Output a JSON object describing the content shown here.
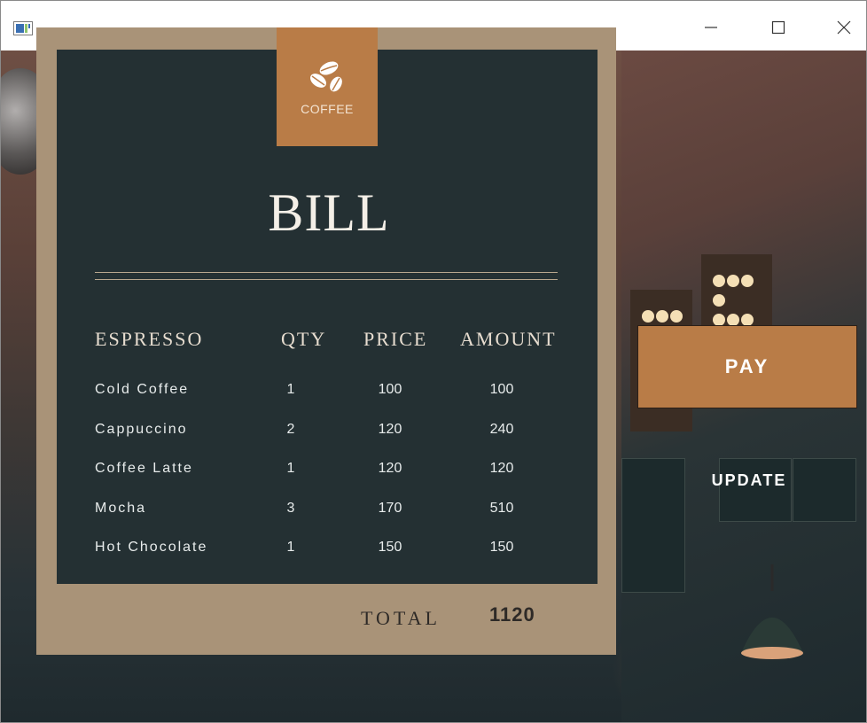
{
  "window": {
    "icon": "app-window-icon",
    "controls": [
      "minimize-icon",
      "maximize-icon",
      "close-icon"
    ]
  },
  "badge": {
    "label": "COFFEE",
    "icon": "coffee-beans-icon"
  },
  "bill": {
    "title": "BILL",
    "columns": [
      "ESPRESSO",
      "QTY",
      "PRICE",
      "AMOUNT"
    ],
    "rows": [
      {
        "item": "Cold Coffee",
        "qty": "1",
        "price": "100",
        "amount": "100"
      },
      {
        "item": "Cappuccino",
        "qty": "2",
        "price": "120",
        "amount": "240"
      },
      {
        "item": "Coffee Latte",
        "qty": "1",
        "price": "120",
        "amount": "120"
      },
      {
        "item": "Mocha",
        "qty": "3",
        "price": "170",
        "amount": "510"
      },
      {
        "item": "Hot Chocolate",
        "qty": "1",
        "price": "150",
        "amount": "150"
      }
    ],
    "total_label": "TOTAL",
    "total_value": "1120"
  },
  "actions": {
    "pay": "PAY",
    "update": "UPDATE"
  },
  "colors": {
    "accent": "#b97c47",
    "card": "#a99378",
    "panel": "#243033"
  }
}
